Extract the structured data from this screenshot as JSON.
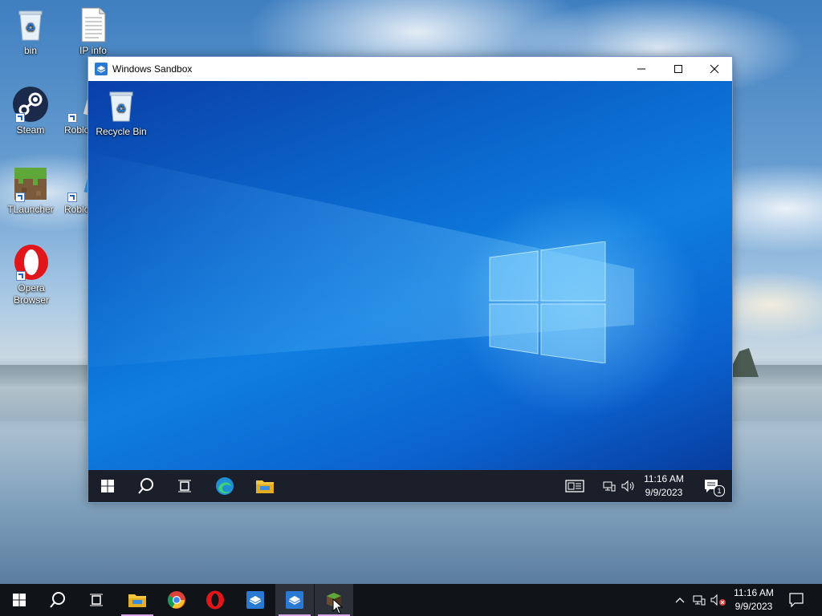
{
  "desktop": {
    "icons": [
      {
        "label": "bin",
        "icon": "recycle-bin-icon"
      },
      {
        "label": "IP info",
        "icon": "text-file-icon"
      },
      {
        "label": "Steam",
        "icon": "steam-icon"
      },
      {
        "label": "Roblo",
        "icon": "roblox-icon"
      },
      {
        "label": "TLauncher",
        "icon": "minecraft-icon"
      },
      {
        "label": "Roblo",
        "icon": "roblox-studio-icon"
      },
      {
        "label": "Opera Browser",
        "icon": "opera-icon"
      }
    ]
  },
  "sandbox_window": {
    "title": "Windows Sandbox",
    "desktop_icon_label": "Recycle Bin",
    "taskbar": {
      "time": "11:16 AM",
      "date": "9/9/2023",
      "notification_count": "1"
    }
  },
  "taskbar": {
    "time": "11:16 AM",
    "date": "9/9/2023"
  },
  "colors": {
    "sandbox_blue": "#0a63c9",
    "taskbar_bg": "#101318",
    "active_indicator": "#d7a4e8"
  }
}
